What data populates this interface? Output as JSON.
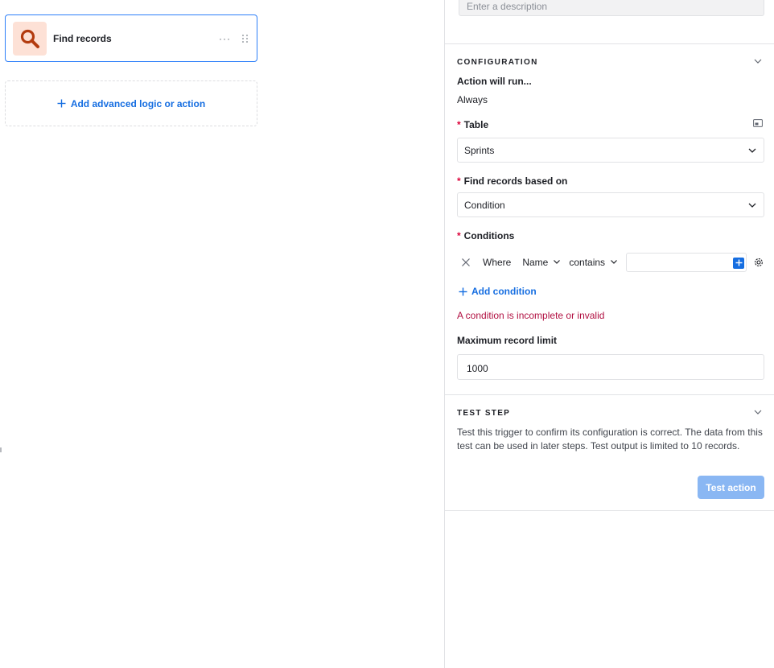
{
  "canvas": {
    "card": {
      "title": "Find records",
      "menu": "···"
    },
    "add_logic": {
      "label": "Add advanced logic or action"
    }
  },
  "panel": {
    "description": {
      "placeholder": "Enter a description"
    },
    "configuration": {
      "heading": "CONFIGURATION",
      "run_label": "Action will run...",
      "run_value": "Always",
      "table_label": "Table",
      "table_value": "Sprints",
      "find_label": "Find records based on",
      "find_value": "Condition",
      "conditions_label": "Conditions",
      "condition": {
        "where": "Where",
        "field": "Name",
        "operator": "contains",
        "value": ""
      },
      "add_condition": "Add condition",
      "error": "A condition is incomplete or invalid",
      "limit_label": "Maximum record limit",
      "limit_value": "1000",
      "required_mark": "*"
    },
    "test_step": {
      "heading": "TEST STEP",
      "description": "Test this trigger to confirm its configuration is correct. The data from this test can be used in later steps. Test output is limited to 10 records.",
      "button": "Test action"
    }
  },
  "colors": {
    "accent": "#166ee1",
    "card_border": "#2d7ff9",
    "icon_bg": "#fde1d6",
    "icon_fg": "#b33b0f",
    "error": "#b10f41",
    "required": "#dc043b",
    "button_disabled": "#8ab7f3"
  },
  "icons": {
    "card": "search-icon",
    "add_logic": "plus-icon",
    "collapse": "chevron-down-icon",
    "remove": "close-icon",
    "settings": "gear-icon",
    "expand": "expand-icon"
  }
}
